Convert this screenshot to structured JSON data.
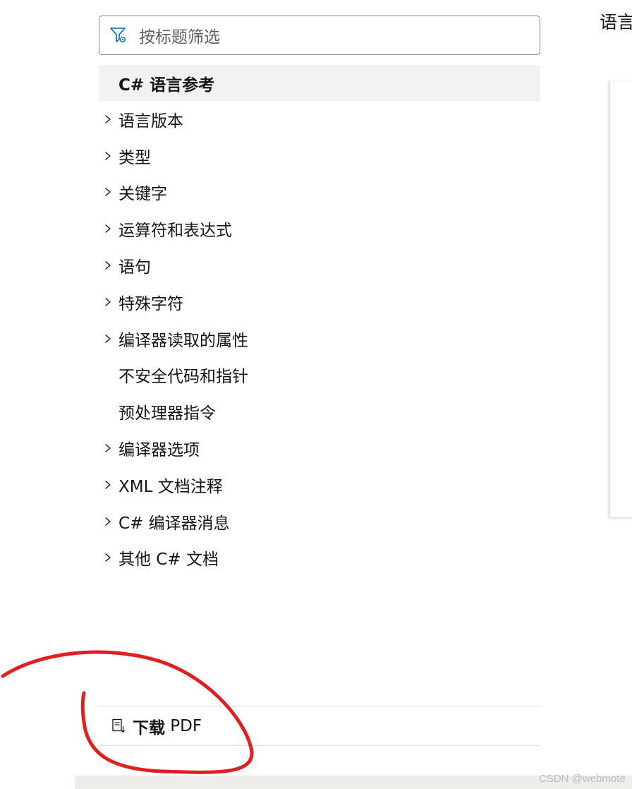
{
  "filter": {
    "placeholder": "按标题筛选",
    "icon": "filter-icon"
  },
  "toc": {
    "header": "C# 语言参考",
    "items": [
      {
        "label": "语言版本",
        "expandable": true
      },
      {
        "label": "类型",
        "expandable": true
      },
      {
        "label": "关键字",
        "expandable": true
      },
      {
        "label": "运算符和表达式",
        "expandable": true
      },
      {
        "label": "语句",
        "expandable": true
      },
      {
        "label": "特殊字符",
        "expandable": true
      },
      {
        "label": "编译器读取的属性",
        "expandable": true
      },
      {
        "label": "不安全代码和指针",
        "expandable": false
      },
      {
        "label": "预处理器指令",
        "expandable": false
      },
      {
        "label": "编译器选项",
        "expandable": true
      },
      {
        "label": "XML 文档注释",
        "expandable": true
      },
      {
        "label": "C# 编译器消息",
        "expandable": true
      },
      {
        "label": "其他 C# 文档",
        "expandable": true
      }
    ]
  },
  "right_panel": {
    "title_partial": "语言"
  },
  "download": {
    "label_bold": "下载",
    "label_rest": " PDF",
    "icon": "pdf-download-icon"
  },
  "watermark": "CSDN @webmote",
  "colors": {
    "accent_blue": "#0065b3",
    "annotation_red": "#e02020",
    "header_bg": "#f2f2f2"
  }
}
